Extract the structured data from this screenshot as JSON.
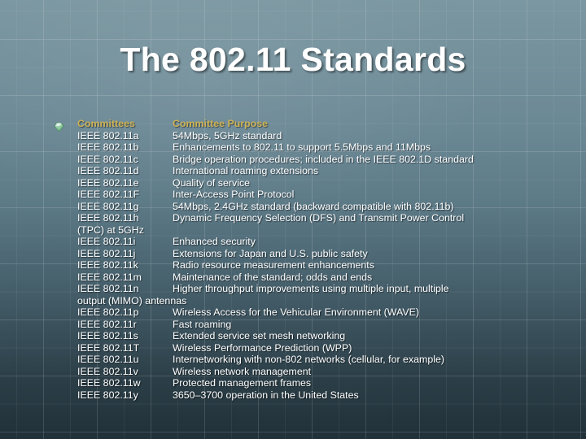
{
  "slide": {
    "title": "The 802.11 Standards",
    "background_color": "#5d7b87",
    "title_color": "#ffffff",
    "header_color": "#cdb255",
    "body_text_color": "#ffffff",
    "bullet_icon": "gem-bullet-icon"
  },
  "table": {
    "headers": {
      "committees": "Committees",
      "purpose": "Committee Purpose"
    },
    "rows": [
      {
        "committee": "IEEE 802.11a",
        "purpose": "54Mbps, 5GHz standard"
      },
      {
        "committee": "IEEE 802.11b",
        "purpose": "Enhancements to 802.11 to support 5.5Mbps and 11Mbps"
      },
      {
        "committee": "IEEE 802.11c",
        "purpose": "Bridge operation procedures; included in the IEEE 802.1D standard"
      },
      {
        "committee": "IEEE 802.11d",
        "purpose": "International roaming extensions"
      },
      {
        "committee": "IEEE 802.11e",
        "purpose": "Quality of service"
      },
      {
        "committee": "IEEE 802.11F",
        "purpose": "Inter-Access Point Protocol"
      },
      {
        "committee": "IEEE 802.11g",
        "purpose": "54Mbps, 2.4GHz standard (backward compatible with 802.11b)"
      },
      {
        "committee": "IEEE 802.11h",
        "purpose": "Dynamic Frequency Selection (DFS) and Transmit Power Control"
      },
      {
        "committee": "(TPC) at 5GHz",
        "purpose": "",
        "continuation": true
      },
      {
        "committee": "IEEE 802.11i",
        "purpose": " Enhanced security"
      },
      {
        "committee": "IEEE 802.11j",
        "purpose": "Extensions for Japan and U.S. public safety"
      },
      {
        "committee": "IEEE 802.11k",
        "purpose": "Radio resource measurement enhancements"
      },
      {
        "committee": "IEEE 802.11m",
        "purpose": "Maintenance of the standard; odds and ends"
      },
      {
        "committee": "IEEE 802.11n",
        "purpose": " Higher throughput improvements using multiple input, multiple"
      },
      {
        "committee": "output (MIMO) antennas",
        "purpose": "",
        "continuation": true
      },
      {
        "committee": "IEEE 802.11p",
        "purpose": "Wireless Access for the Vehicular Environment (WAVE)"
      },
      {
        "committee": "IEEE 802.11r",
        "purpose": "Fast roaming"
      },
      {
        "committee": "IEEE 802.11s",
        "purpose": "Extended service set mesh networking"
      },
      {
        "committee": "IEEE 802.11T",
        "purpose": "Wireless Performance Prediction (WPP)"
      },
      {
        "committee": "IEEE 802.11u",
        "purpose": "Internetworking with non-802 networks (cellular, for example)"
      },
      {
        "committee": "IEEE 802.11v",
        "purpose": "Wireless network management"
      },
      {
        "committee": "IEEE 802.11w",
        "purpose": " Protected management frames"
      },
      {
        "committee": "IEEE 802.11y",
        "purpose": "3650–3700 operation in the United States"
      }
    ]
  }
}
